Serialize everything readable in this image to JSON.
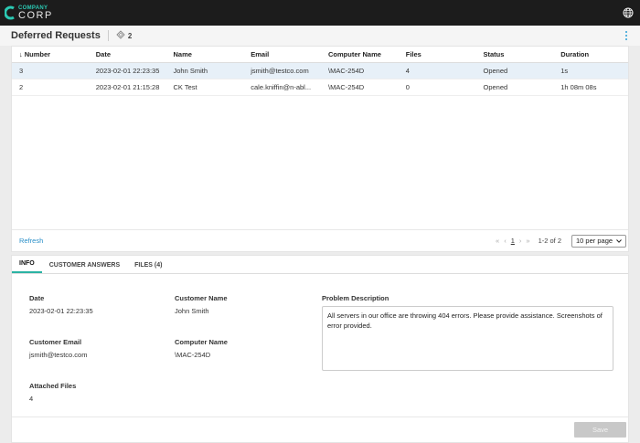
{
  "header": {
    "logo_small": "COMPANY",
    "logo_big": "CORP",
    "accent_color": "#2bc9b3",
    "right_icon": "globe-icon"
  },
  "page": {
    "title": "Deferred Requests",
    "count": "2",
    "count_icon": "tag-icon",
    "menu_icon": "kebab-menu-icon"
  },
  "table": {
    "sort_indicator": "↓",
    "columns": [
      "Number",
      "Date",
      "Name",
      "Email",
      "Computer Name",
      "Files",
      "Status",
      "Duration"
    ],
    "rows": [
      [
        "3",
        "2023-02-01 22:23:35",
        "John Smith",
        "jsmith@testco.com",
        "\\MAC-254D",
        "4",
        "Opened",
        "1s"
      ],
      [
        "2",
        "2023-02-01 21:15:28",
        "CK Test",
        "cale.kniffin@n-abl...",
        "\\MAC-254D",
        "0",
        "Opened",
        "1h 08m 08s"
      ]
    ],
    "selected_row": 0
  },
  "footer": {
    "refresh_label": "Refresh",
    "first": "«",
    "prev": "‹",
    "page": "1",
    "next": "›",
    "last": "»",
    "range": "1-2 of 2",
    "per_page": "10 per page"
  },
  "tabs": [
    {
      "label": "INFO",
      "active": true
    },
    {
      "label": "CUSTOMER ANSWERS",
      "active": false
    },
    {
      "label": "FILES (4)",
      "active": false
    }
  ],
  "detail": {
    "date_label": "Date",
    "date_value": "2023-02-01 22:23:35",
    "customer_name_label": "Customer Name",
    "customer_name_value": "John Smith",
    "problem_label": "Problem Description",
    "problem_value": "All servers in our office are throwing 404 errors. Please provide assistance. Screenshots of error provided.",
    "email_label": "Customer Email",
    "email_value": "jsmith@testco.com",
    "computer_label": "Computer Name",
    "computer_value": "\\MAC-254D",
    "files_label": "Attached Files",
    "files_value": "4"
  },
  "actions": {
    "save_label": "Save"
  }
}
